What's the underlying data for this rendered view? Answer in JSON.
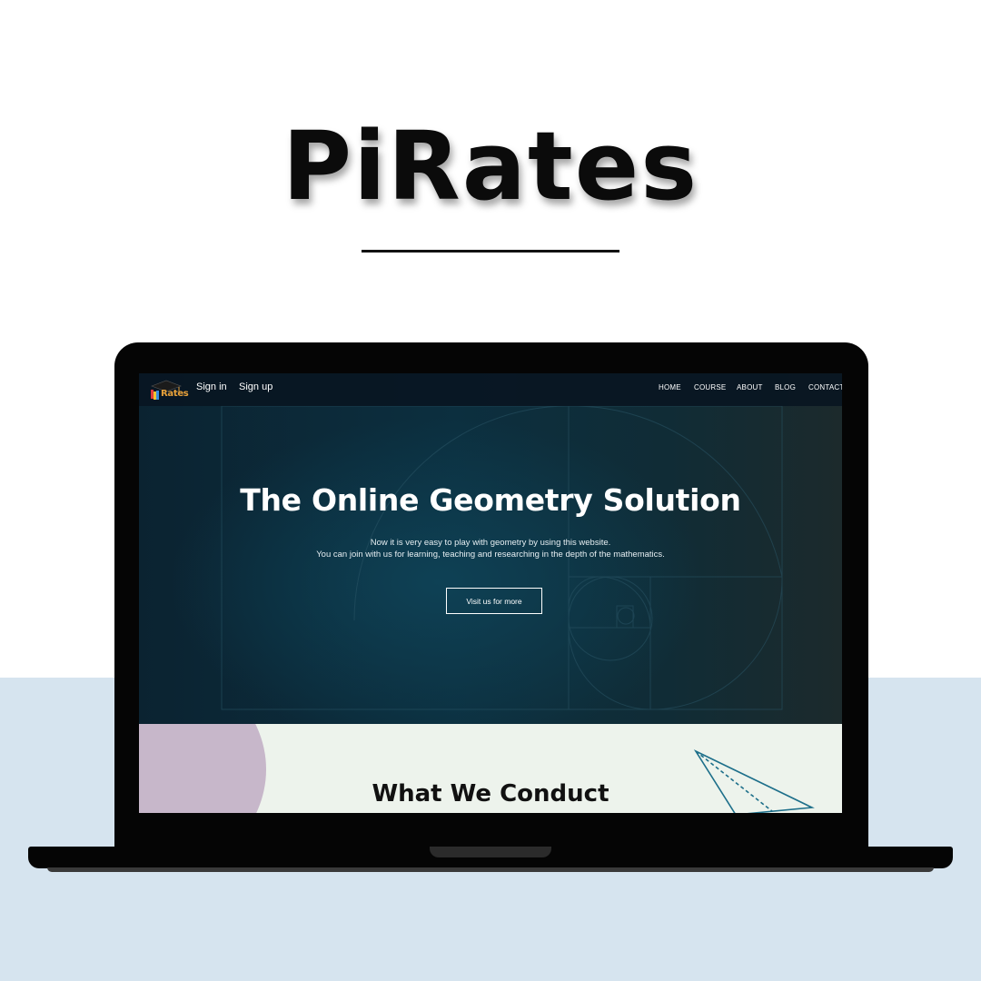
{
  "page": {
    "title": "PiRates"
  },
  "site": {
    "logo_text": "Rates",
    "auth": {
      "sign_in": "Sign in",
      "sign_up": "Sign up"
    },
    "nav": [
      "HOME",
      "COURSE",
      "ABOUT",
      "BLOG",
      "CONTACT"
    ],
    "hero": {
      "heading": "The Online Geometry Solution",
      "line1": "Now it is very easy to play with geometry by using this website.",
      "line2": "You can join with us for learning, teaching and researching in the depth of the mathematics.",
      "cta": "Visit us for more"
    },
    "section": {
      "heading": "What We Conduct"
    }
  },
  "colors": {
    "background": "#ffffff",
    "lower_band": "#d6e4ef",
    "hero_bg": "#0c2f3f",
    "navbar_bg": "#091622",
    "section_bg": "#edf3ec",
    "blob": "#c7b7ca",
    "triangle_stroke": "#1d6f8a",
    "logo_accent": "#e8a13a"
  },
  "icons": [
    "graduation-cap-logo-icon",
    "paper-plane-triangle-icon"
  ]
}
